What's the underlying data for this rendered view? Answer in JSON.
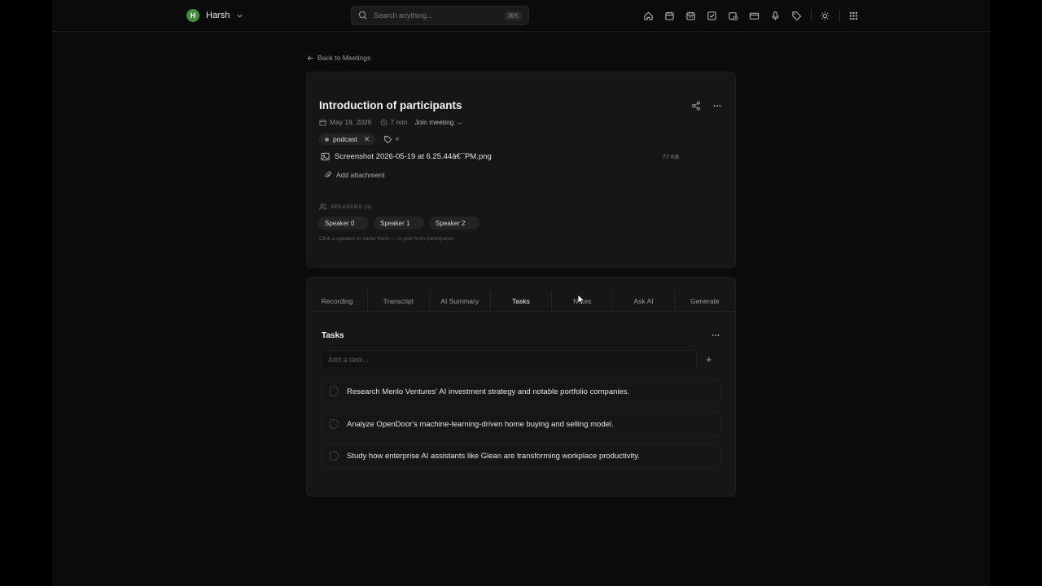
{
  "topbar": {
    "user_initial": "H",
    "user_name": "Harsh",
    "search_placeholder": "Search anything...",
    "search_shortcut": "⌘K",
    "tool_icons": [
      "home-icon",
      "calendar-icon",
      "calendar-grid-icon",
      "checkbox-icon",
      "calendar-clock-icon",
      "card-icon",
      "microphone-icon",
      "tag-icon",
      "sun-icon",
      "apps-grid-icon"
    ]
  },
  "back_link": "Back to Meetings",
  "meeting": {
    "title": "Introduction of participants",
    "date": "May 19, 2026",
    "duration": "7 min",
    "join_label": "Join meeting →",
    "tag": "podcast",
    "tag_add": "+",
    "file_name": "Screenshot 2026-05-19 at 6.25.44â€¯PM.png",
    "file_size": "77 KB",
    "add_attachment": "Add attachment",
    "speakers_heading": "SPEAKERS (3)",
    "speakers": [
      "Speaker 0",
      "Speaker 1",
      "Speaker 2"
    ],
    "speakers_hint": "Click a speaker to name them — or pick from participants"
  },
  "tabs": [
    "Recording",
    "Transcript",
    "AI Summary",
    "Tasks",
    "Notes",
    "Ask AI",
    "Generate"
  ],
  "active_tab": "Tasks",
  "tasks": {
    "title": "Tasks",
    "input_placeholder": "Add a task...",
    "add_label": "+",
    "items": [
      "Research Menlo Ventures' AI investment strategy and notable portfolio companies.",
      "Analyze OpenDoor's machine-learning-driven home buying and selling model.",
      "Study how enterprise AI assistants like Glean are transforming workplace productivity."
    ]
  },
  "colors": {
    "background": "#0b0b0b",
    "card": "#161616",
    "avatar": "#3f8f3a"
  }
}
